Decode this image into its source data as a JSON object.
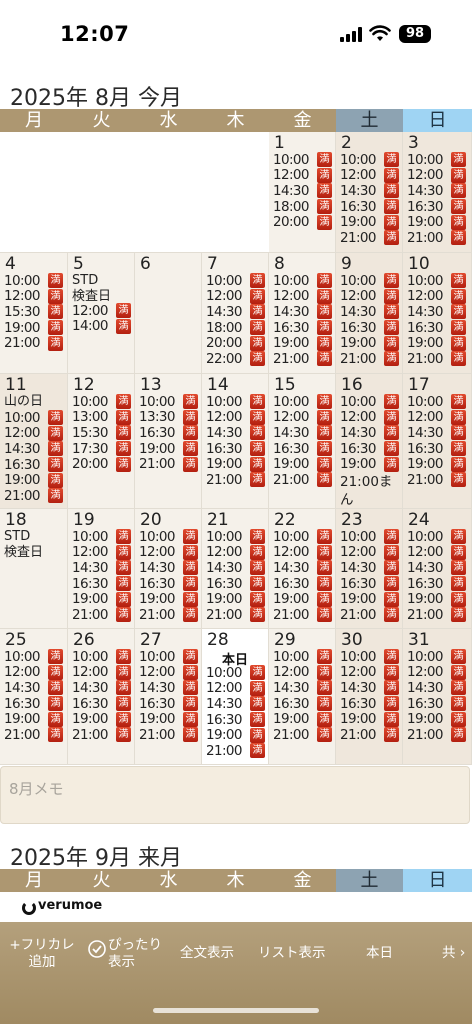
{
  "status_bar": {
    "time": "12:07",
    "battery": "98"
  },
  "month1": {
    "title": "2025年 8月 今月"
  },
  "month2": {
    "title": "2025年 9月 来月"
  },
  "weekdays": [
    "月",
    "火",
    "水",
    "木",
    "金",
    "土",
    "日"
  ],
  "slot_badge": "満",
  "calendar": {
    "weeks": [
      {
        "days": [
          {
            "blank": true
          },
          {
            "blank": true
          },
          {
            "blank": true
          },
          {
            "blank": true
          },
          {
            "num": "1",
            "slots": [
              "10:00",
              "12:00",
              "14:30",
              "18:00",
              "20:00"
            ]
          },
          {
            "num": "2",
            "weekend": true,
            "slots": [
              "10:00",
              "12:00",
              "14:30",
              "16:30",
              "19:00",
              "21:00"
            ]
          },
          {
            "num": "3",
            "weekend": true,
            "slots": [
              "10:00",
              "12:00",
              "14:30",
              "16:30",
              "19:00",
              "21:00"
            ]
          }
        ]
      },
      {
        "days": [
          {
            "num": "4",
            "slots": [
              "10:00",
              "12:00",
              "15:30",
              "19:00",
              "21:00"
            ]
          },
          {
            "num": "5",
            "note": "STD\n検査日",
            "slots": [
              "12:00",
              "14:00"
            ]
          },
          {
            "num": "6",
            "slots": []
          },
          {
            "num": "7",
            "slots": [
              "10:00",
              "12:00",
              "14:30",
              "18:00",
              "20:00",
              "22:00"
            ]
          },
          {
            "num": "8",
            "slots": [
              "10:00",
              "12:00",
              "14:30",
              "16:30",
              "19:00",
              "21:00"
            ]
          },
          {
            "num": "9",
            "weekend": true,
            "slots": [
              "10:00",
              "12:00",
              "14:30",
              "16:30",
              "19:00",
              "21:00"
            ]
          },
          {
            "num": "10",
            "weekend": true,
            "slots": [
              "10:00",
              "12:00",
              "14:30",
              "16:30",
              "19:00",
              "21:00"
            ]
          }
        ]
      },
      {
        "days": [
          {
            "num": "11",
            "weekend": true,
            "note": "山の日",
            "slots": [
              "10:00",
              "12:00",
              "14:30",
              "16:30",
              "19:00",
              "21:00"
            ]
          },
          {
            "num": "12",
            "slots": [
              "10:00",
              "13:00",
              "15:30",
              "17:30",
              "20:00"
            ]
          },
          {
            "num": "13",
            "slots": [
              "10:00",
              "13:30",
              "16:30",
              "19:00",
              "21:00"
            ]
          },
          {
            "num": "14",
            "slots": [
              "10:00",
              "12:00",
              "14:30",
              "16:30",
              "19:00",
              "21:00"
            ]
          },
          {
            "num": "15",
            "slots": [
              "10:00",
              "12:00",
              "14:30",
              "16:30",
              "19:00",
              "21:00"
            ]
          },
          {
            "num": "16",
            "weekend": true,
            "slots": [
              "10:00",
              "12:00",
              "14:30",
              "16:30",
              "19:00"
            ],
            "last_text": "21:00ま",
            "last_wrap": "ん"
          },
          {
            "num": "17",
            "weekend": true,
            "slots": [
              "10:00",
              "12:00",
              "14:30",
              "16:30",
              "19:00",
              "21:00"
            ]
          }
        ]
      },
      {
        "days": [
          {
            "num": "18",
            "note": "STD\n検査日",
            "slots": []
          },
          {
            "num": "19",
            "slots": [
              "10:00",
              "12:00",
              "14:30",
              "16:30",
              "19:00",
              "21:00"
            ]
          },
          {
            "num": "20",
            "slots": [
              "10:00",
              "12:00",
              "14:30",
              "16:30",
              "19:00",
              "21:00"
            ]
          },
          {
            "num": "21",
            "slots": [
              "10:00",
              "12:00",
              "14:30",
              "16:30",
              "19:00",
              "21:00"
            ]
          },
          {
            "num": "22",
            "slots": [
              "10:00",
              "12:00",
              "14:30",
              "16:30",
              "19:00",
              "21:00"
            ]
          },
          {
            "num": "23",
            "weekend": true,
            "slots": [
              "10:00",
              "12:00",
              "14:30",
              "16:30",
              "19:00",
              "21:00"
            ]
          },
          {
            "num": "24",
            "weekend": true,
            "slots": [
              "10:00",
              "12:00",
              "14:30",
              "16:30",
              "19:00",
              "21:00"
            ]
          }
        ]
      },
      {
        "days": [
          {
            "num": "25",
            "slots": [
              "10:00",
              "12:00",
              "14:30",
              "16:30",
              "19:00",
              "21:00"
            ]
          },
          {
            "num": "26",
            "slots": [
              "10:00",
              "12:00",
              "14:30",
              "16:30",
              "19:00",
              "21:00"
            ]
          },
          {
            "num": "27",
            "slots": [
              "10:00",
              "12:00",
              "14:30",
              "16:30",
              "19:00",
              "21:00"
            ]
          },
          {
            "num": "28",
            "today": true,
            "today_label": "本日",
            "slots": [
              "10:00",
              "12:00",
              "14:30",
              "16:30",
              "19:00",
              "21:00"
            ]
          },
          {
            "num": "29",
            "slots": [
              "10:00",
              "12:00",
              "14:30",
              "16:30",
              "19:00",
              "21:00"
            ]
          },
          {
            "num": "30",
            "weekend": true,
            "slots": [
              "10:00",
              "12:00",
              "14:30",
              "16:30",
              "19:00",
              "21:00"
            ]
          },
          {
            "num": "31",
            "weekend": true,
            "slots": [
              "10:00",
              "12:00",
              "14:30",
              "16:30",
              "19:00",
              "21:00"
            ]
          }
        ]
      }
    ]
  },
  "memo": {
    "label": "8月メモ"
  },
  "brand": {
    "name": "verumoe"
  },
  "toolbar": {
    "add_label": "+フリカレ\n追加",
    "fit_label": "ぴったり\n表示",
    "full_label": "全文表示",
    "list_label": "リスト表示",
    "today_label": "本日",
    "share_label": "共"
  }
}
